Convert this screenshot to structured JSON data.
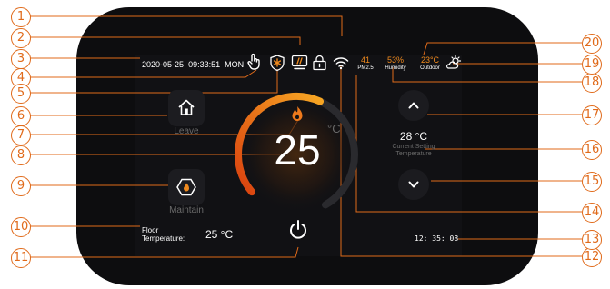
{
  "status_bar": {
    "date": "2020-05-25",
    "time": "09:33:51",
    "weekday": "MON",
    "pm25_value": "41",
    "pm25_label": "PM2.5",
    "humidity_value": "53%",
    "humidity_label": "Humidity",
    "outdoor_value": "23°C",
    "outdoor_label": "Outdoor"
  },
  "modes": {
    "leave_label": "Leave",
    "maintain_label": "Maintain"
  },
  "dial": {
    "temperature": "25",
    "unit": "°C",
    "fill_fraction": 0.55
  },
  "setpoint": {
    "value": "28 °C",
    "label_line1": "Current Setting",
    "label_line2": "Temperature"
  },
  "floor": {
    "label_line1": "Floor",
    "label_line2": "Temperature:",
    "value": "25 °C"
  },
  "clock": "12: 35: 08",
  "colors": {
    "accent_orange": "#f08a1e",
    "callout": "#e06a1a",
    "screen_bg": "#111114",
    "bezel": "#0d0d0f"
  },
  "callouts": [
    "1",
    "2",
    "3",
    "4",
    "5",
    "6",
    "7",
    "8",
    "9",
    "10",
    "11",
    "12",
    "13",
    "14",
    "15",
    "16",
    "17",
    "18",
    "19",
    "20"
  ]
}
